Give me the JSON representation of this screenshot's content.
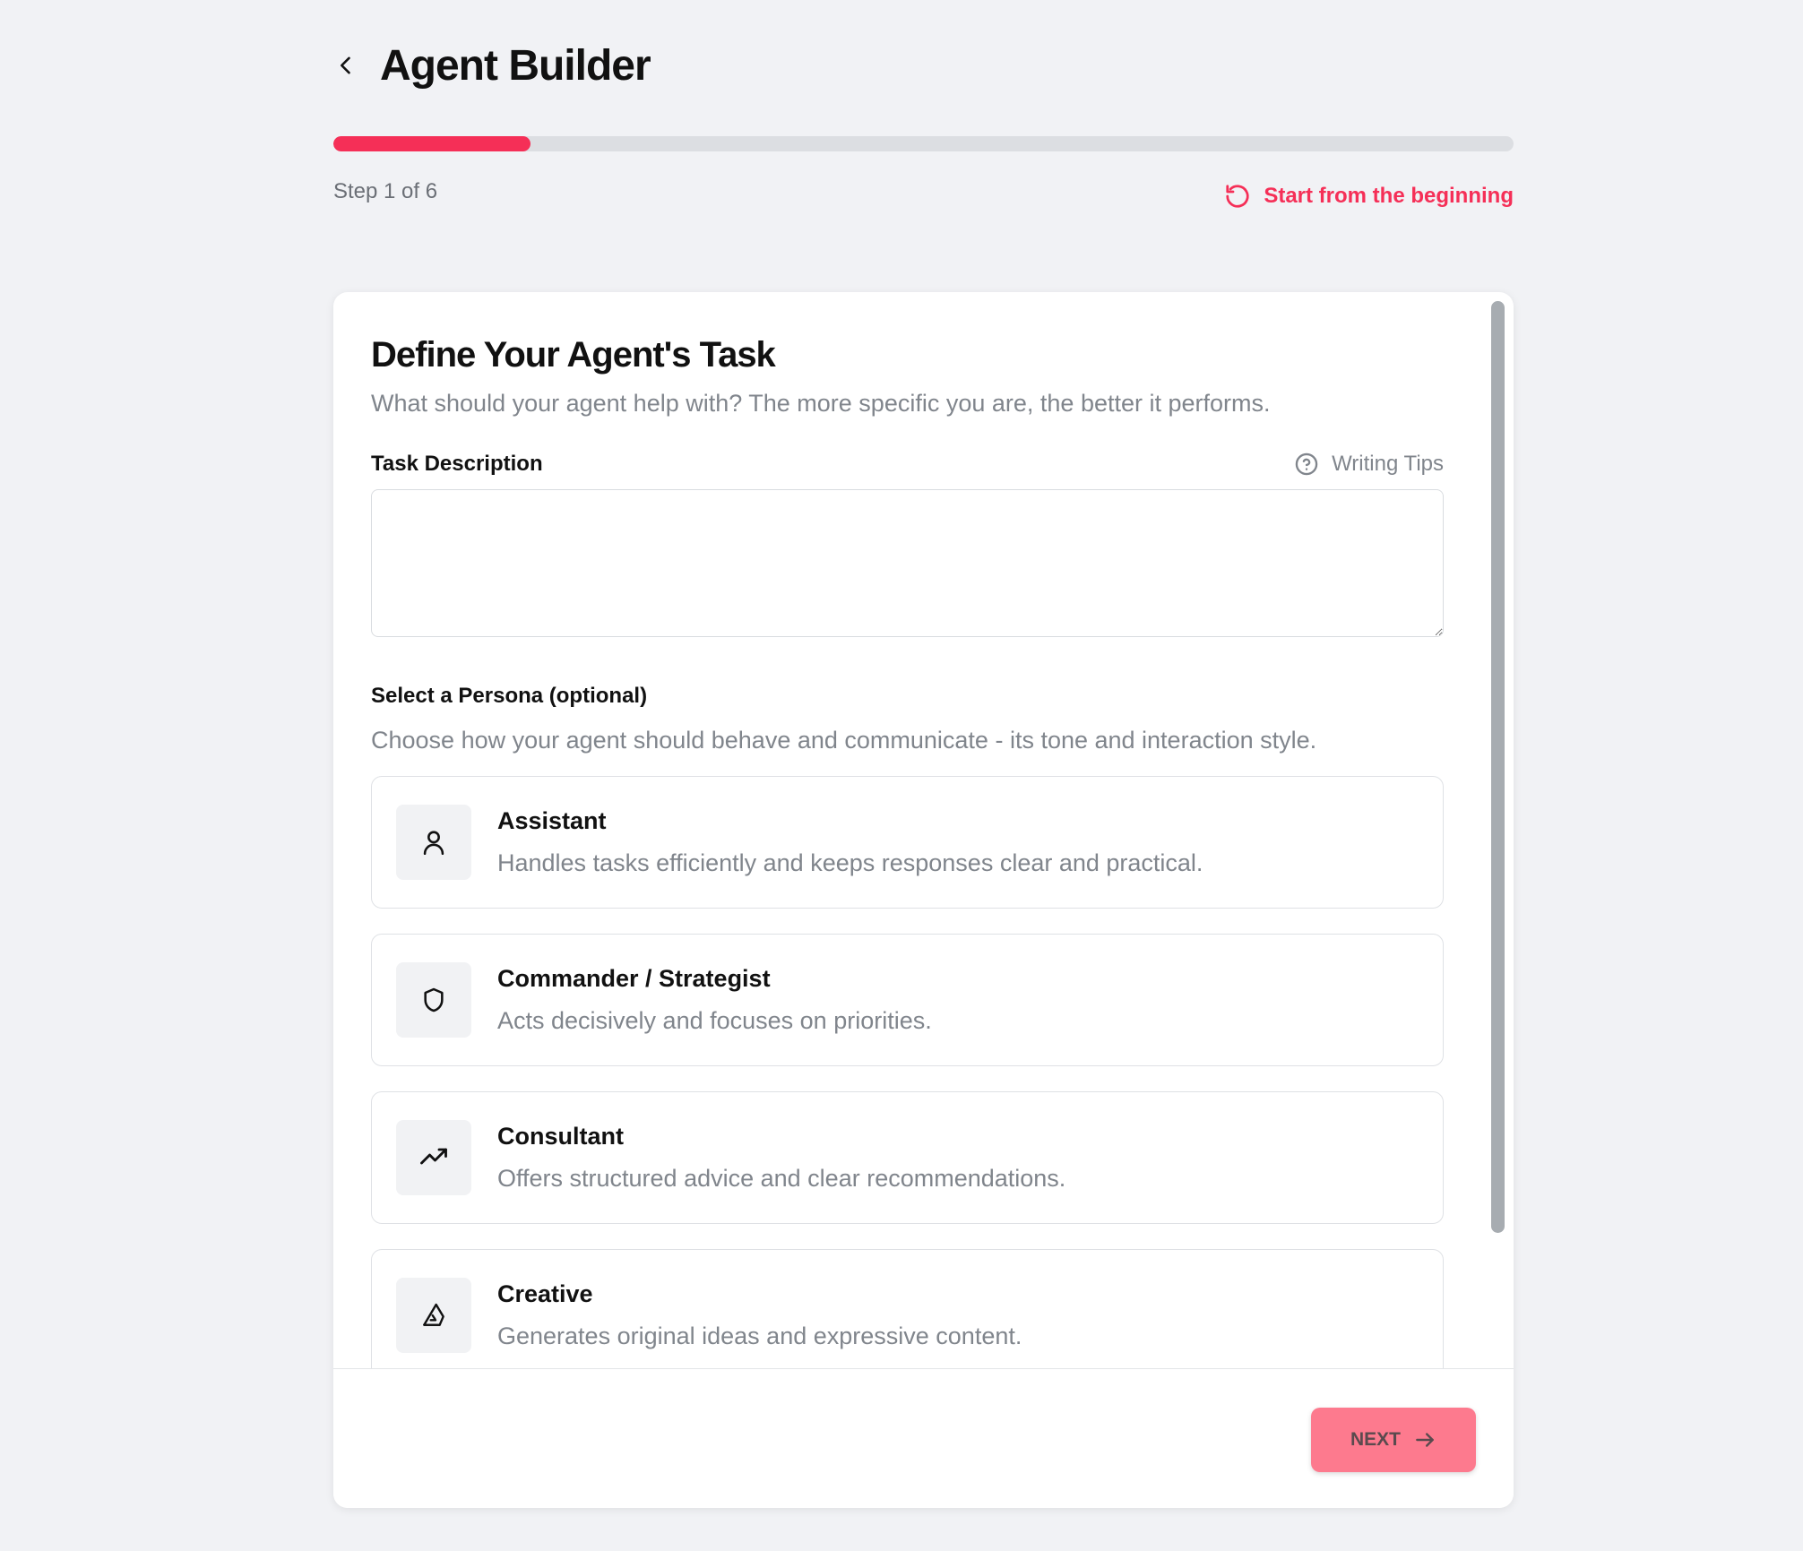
{
  "header": {
    "title": "Agent Builder",
    "step_label": "Step 1 of 6",
    "progress_fraction": 0.1667,
    "restart_label": "Start from the beginning"
  },
  "card": {
    "title": "Define Your Agent's Task",
    "subtitle": "What should your agent help with? The more specific you are, the better it performs.",
    "task_label": "Task Description",
    "tips_label": "Writing Tips",
    "task_value": "",
    "persona_label": "Select a Persona (optional)",
    "persona_desc": "Choose how your agent should behave and communicate - its tone and interaction style.",
    "personas": [
      {
        "title": "Assistant",
        "desc": "Handles tasks efficiently and keeps responses clear and practical.",
        "icon": "user-icon"
      },
      {
        "title": "Commander / Strategist",
        "desc": "Acts decisively and focuses on priorities.",
        "icon": "shield-icon"
      },
      {
        "title": "Consultant",
        "desc": "Offers structured advice and clear recommendations.",
        "icon": "trending-up-icon"
      },
      {
        "title": "Creative",
        "desc": "Generates original ideas and expressive content.",
        "icon": "paint-icon"
      }
    ]
  },
  "footer": {
    "next_label": "NEXT"
  },
  "colors": {
    "accent": "#f52f57",
    "next_button": "#fd7a8e",
    "background": "#f1f2f5"
  }
}
